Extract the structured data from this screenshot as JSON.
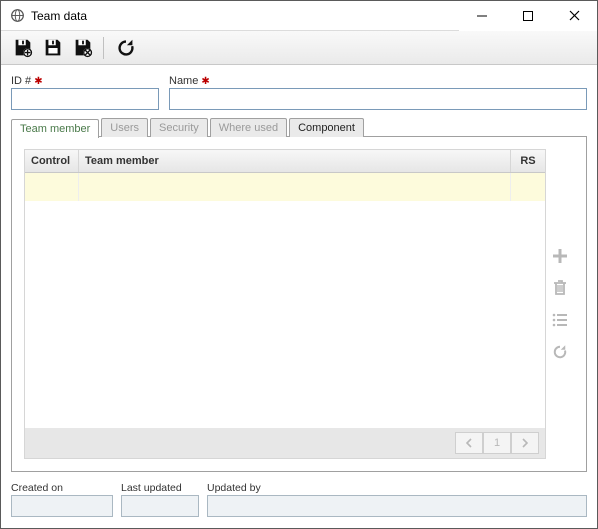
{
  "window": {
    "title": "Team data"
  },
  "toolbar": {
    "icons": [
      "save-new-icon",
      "save-icon",
      "save-close-icon",
      "refresh-icon"
    ]
  },
  "form": {
    "id_label": "ID #",
    "id_value": "",
    "name_label": "Name",
    "name_value": ""
  },
  "tabs": [
    {
      "label": "Team member",
      "active": true
    },
    {
      "label": "Users",
      "active": false
    },
    {
      "label": "Security",
      "active": false
    },
    {
      "label": "Where used",
      "active": false
    },
    {
      "label": "Component",
      "active": false,
      "link": true
    }
  ],
  "grid": {
    "columns": {
      "control": "Control",
      "team_member": "Team member",
      "rs": "RS"
    },
    "pager": {
      "prev": "◄",
      "page": "1",
      "next": "►"
    }
  },
  "footer": {
    "created_on_label": "Created on",
    "created_on": "",
    "last_updated_label": "Last updated",
    "last_updated": "",
    "updated_by_label": "Updated by",
    "updated_by": ""
  }
}
